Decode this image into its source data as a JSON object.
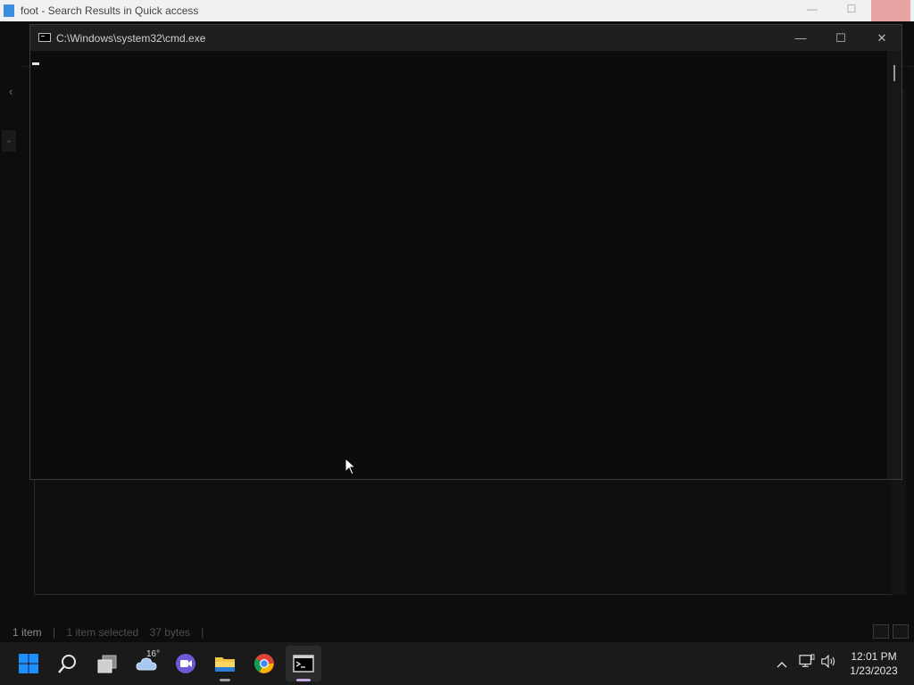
{
  "explorer": {
    "title": "foot - Search Results in Quick access",
    "status": {
      "item_count": "1 item",
      "selected": "1 item selected",
      "size": "37 bytes"
    }
  },
  "cmd": {
    "title": "C:\\Windows\\system32\\cmd.exe",
    "minimize_label": "—",
    "maximize_label": "☐",
    "close_label": "✕"
  },
  "taskbar": {
    "apps": [
      {
        "name": "Start",
        "icon": "windows-logo-icon"
      },
      {
        "name": "Search",
        "icon": "search-icon"
      },
      {
        "name": "Task View",
        "icon": "task-view-icon"
      },
      {
        "name": "Weather",
        "icon": "cloud-icon"
      },
      {
        "name": "Teams Chat",
        "icon": "video-chat-icon"
      },
      {
        "name": "File Explorer",
        "icon": "folder-icon"
      },
      {
        "name": "Google Chrome",
        "icon": "chrome-icon"
      },
      {
        "name": "Command Prompt",
        "icon": "terminal-icon"
      }
    ],
    "weather_temp": "16°",
    "tray": {
      "chevron": "^",
      "network_icon": "network-icon",
      "volume_icon": "volume-icon"
    },
    "clock": {
      "time": "12:01 PM",
      "date": "1/23/2023"
    }
  },
  "colors": {
    "accent": "#0078d4",
    "active_indicator": "#c7a6e6",
    "console_bg": "#0c0c0c"
  }
}
